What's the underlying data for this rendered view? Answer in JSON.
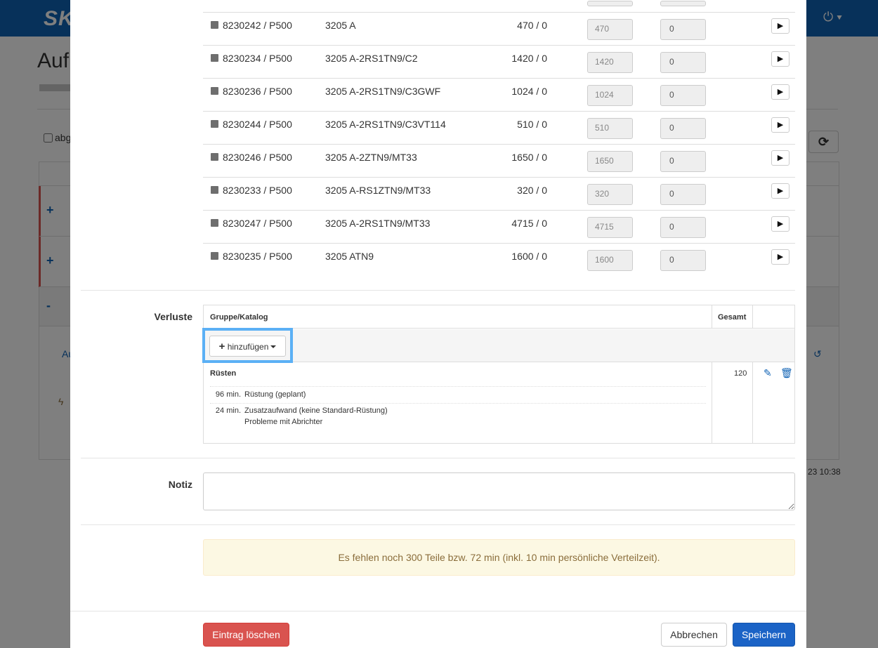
{
  "background": {
    "logo": "SKF",
    "power_icon": "power-icon",
    "page_title": "Auf",
    "checkbox_label": "abg",
    "side_link": "Au",
    "footer_time": "23 10:38",
    "row_toggles": [
      "+",
      "+",
      "-"
    ]
  },
  "items": [
    {
      "article": "8230242 / P500",
      "name": "3205 A",
      "qty": "470 / 0",
      "input1": "470",
      "input2": "0"
    },
    {
      "article": "8230234 / P500",
      "name": "3205 A-2RS1TN9/C2",
      "qty": "1420 / 0",
      "input1": "1420",
      "input2": "0"
    },
    {
      "article": "8230236 / P500",
      "name": "3205 A-2RS1TN9/C3GWF",
      "qty": "1024 / 0",
      "input1": "1024",
      "input2": "0"
    },
    {
      "article": "8230244 / P500",
      "name": "3205 A-2RS1TN9/C3VT114",
      "qty": "510 / 0",
      "input1": "510",
      "input2": "0"
    },
    {
      "article": "8230246 / P500",
      "name": "3205 A-2ZTN9/MT33",
      "qty": "1650 / 0",
      "input1": "1650",
      "input2": "0"
    },
    {
      "article": "8230233 / P500",
      "name": "3205 A-RS1ZTN9/MT33",
      "qty": "320 / 0",
      "input1": "320",
      "input2": "0"
    },
    {
      "article": "8230247 / P500",
      "name": "3205 A-2RS1TN9/MT33",
      "qty": "4715 / 0",
      "input1": "4715",
      "input2": "0"
    },
    {
      "article": "8230235 / P500",
      "name": "3205 ATN9",
      "qty": "1600 / 0",
      "input1": "1600",
      "input2": "0"
    }
  ],
  "verluste": {
    "label": "Verluste",
    "col_group": "Gruppe/Katalog",
    "col_total": "Gesamt",
    "add_button": "hinzufügen",
    "group": {
      "title": "Rüsten",
      "total": "120",
      "entries": [
        {
          "min": "96 min.",
          "text": "Rüstung (geplant)",
          "note": ""
        },
        {
          "min": "24 min.",
          "text": "Zusatzaufwand (keine Standard-Rüstung)",
          "note": "Probleme mit Abrichter"
        }
      ]
    }
  },
  "notiz": {
    "label": "Notiz",
    "value": ""
  },
  "alert": {
    "text": "Es fehlen noch 300 Teile bzw. 72 min (inkl. 10 min persönliche Verteilzeit)."
  },
  "footer": {
    "delete_label": "Eintrag löschen",
    "cancel_label": "Abbrechen",
    "save_label": "Speichern"
  },
  "colors": {
    "brand": "#0f62b4",
    "danger": "#d9534f",
    "primary": "#1b63c6",
    "focus": "#5bb0f5",
    "warning_bg": "#fcf8e3"
  }
}
